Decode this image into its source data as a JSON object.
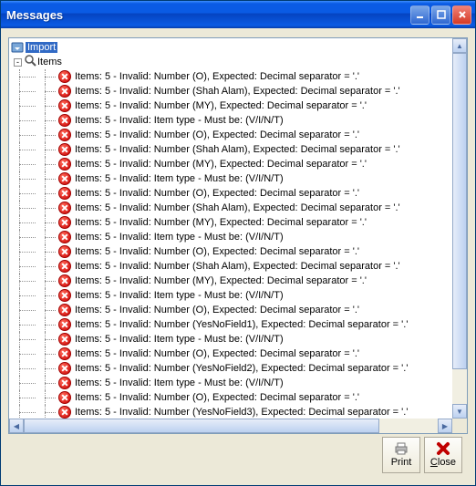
{
  "window": {
    "title": "Messages"
  },
  "tree": {
    "root_label": "Import",
    "items_label": "Items",
    "messages": [
      "Items: 5 - Invalid: Number (O), Expected: Decimal separator = '.'",
      "Items: 5 - Invalid: Number (Shah Alam), Expected: Decimal separator = '.'",
      "Items: 5 - Invalid: Number (MY), Expected: Decimal separator = '.'",
      "Items: 5 -  Invalid: Item type - Must be: (V/I/N/T)",
      "Items: 5 - Invalid: Number (O), Expected: Decimal separator = '.'",
      "Items: 5 - Invalid: Number (Shah Alam), Expected: Decimal separator = '.'",
      "Items: 5 - Invalid: Number (MY), Expected: Decimal separator = '.'",
      "Items: 5 -  Invalid: Item type - Must be: (V/I/N/T)",
      "Items: 5 - Invalid: Number (O), Expected: Decimal separator = '.'",
      "Items: 5 - Invalid: Number (Shah Alam), Expected: Decimal separator = '.'",
      "Items: 5 - Invalid: Number (MY), Expected: Decimal separator = '.'",
      "Items: 5 -  Invalid: Item type - Must be: (V/I/N/T)",
      "Items: 5 - Invalid: Number (O), Expected: Decimal separator = '.'",
      "Items: 5 - Invalid: Number (Shah Alam), Expected: Decimal separator = '.'",
      "Items: 5 - Invalid: Number (MY), Expected: Decimal separator = '.'",
      "Items: 5 -  Invalid: Item type - Must be: (V/I/N/T)",
      "Items: 5 - Invalid: Number (O), Expected: Decimal separator = '.'",
      "Items: 5 - Invalid: Number (YesNoField1), Expected: Decimal separator = '.'",
      "Items: 5 -  Invalid: Item type - Must be: (V/I/N/T)",
      "Items: 5 - Invalid: Number (O), Expected: Decimal separator = '.'",
      "Items: 5 - Invalid: Number (YesNoField2), Expected: Decimal separator = '.'",
      "Items: 5 -  Invalid: Item type - Must be: (V/I/N/T)",
      "Items: 5 - Invalid: Number (O), Expected: Decimal separator = '.'",
      "Items: 5 - Invalid: Number (YesNoField3), Expected: Decimal separator = '.'"
    ]
  },
  "buttons": {
    "print": "Print",
    "close_prefix": "",
    "close_letter": "C",
    "close_rest": "lose"
  }
}
